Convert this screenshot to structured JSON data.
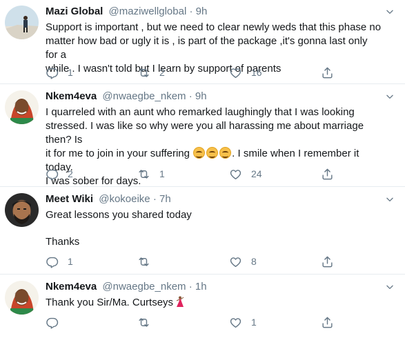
{
  "colors": {
    "primary_text": "#14171a",
    "secondary_text": "#657786",
    "divider": "#e6ecf0",
    "background": "#ffffff"
  },
  "tweets": [
    {
      "name": "Mazi Global",
      "handle": "@maziwellglobal",
      "separator": "·",
      "time": "9h",
      "lines": [
        "Support is important , but we need to clear newly weds that this phase no",
        "matter how bad or ugly it is , is part of the package ,it's gonna last only for a",
        "while . I wasn't told but I learn by support of parents"
      ],
      "replies": "1",
      "retweets": "2",
      "likes": "16",
      "icons": [
        "caret-down-icon",
        "reply-icon",
        "retweet-icon",
        "like-icon",
        "share-icon"
      ]
    },
    {
      "name": "Nkem4eva",
      "handle": "@nwaegbe_nkem",
      "separator": "·",
      "time": "9h",
      "lines": [
        "I quarreled with an aunt who remarked laughingly that I was looking",
        "stressed. I was like so why were you all harassing me about marriage then? Is",
        "it for me to join in your suffering",
        ". I smile when I remember it today.",
        "I was sober for days."
      ],
      "replies": "2",
      "retweets": "1",
      "likes": "24",
      "emojis": [
        "smiling-face-emoji",
        "smiling-face-emoji",
        "smiling-face-emoji"
      ]
    },
    {
      "name": "Meet Wiki",
      "handle": "@kokoeike",
      "separator": "·",
      "time": "7h",
      "lines": [
        "Great lessons you shared today",
        "Thanks"
      ],
      "replies": "1",
      "retweets": "",
      "likes": "8"
    },
    {
      "name": "Nkem4eva",
      "handle": "@nwaegbe_nkem",
      "separator": "·",
      "time": "1h",
      "lines": [
        "Thank you Sir/Ma. Curtseys"
      ],
      "replies": "",
      "retweets": "",
      "likes": "1",
      "emojis": [
        "dancer-emoji"
      ]
    }
  ]
}
